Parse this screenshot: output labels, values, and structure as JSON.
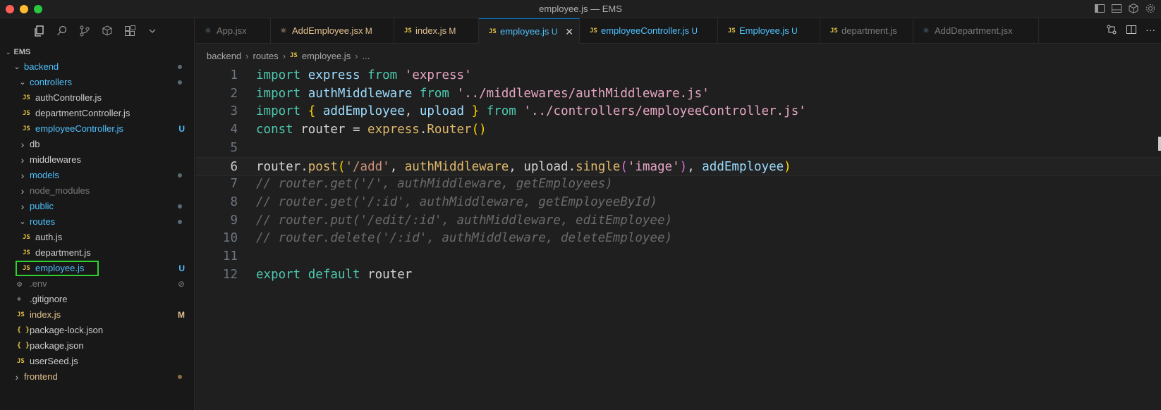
{
  "window": {
    "title": "employee.js — EMS"
  },
  "explorer": {
    "root": "EMS",
    "items": [
      {
        "label": "backend",
        "indent": 1,
        "type": "folder-open",
        "color": "#4fc1ff",
        "dot": true
      },
      {
        "label": "controllers",
        "indent": 2,
        "type": "folder-open",
        "color": "#4fc1ff",
        "dot": true
      },
      {
        "label": "authController.js",
        "indent": 3,
        "type": "js",
        "color": "#cccccc"
      },
      {
        "label": "departmentController.js",
        "indent": 3,
        "type": "js",
        "color": "#cccccc"
      },
      {
        "label": "employeeController.js",
        "indent": 3,
        "type": "js",
        "color": "#4fc1ff",
        "badge": "U",
        "badgeColor": "#4fc1ff"
      },
      {
        "label": "db",
        "indent": 2,
        "type": "folder",
        "color": "#cccccc"
      },
      {
        "label": "middlewares",
        "indent": 2,
        "type": "folder",
        "color": "#cccccc"
      },
      {
        "label": "models",
        "indent": 2,
        "type": "folder",
        "color": "#4fc1ff",
        "dot": true
      },
      {
        "label": "node_modules",
        "indent": 2,
        "type": "folder",
        "color": "#7a7a7a"
      },
      {
        "label": "public",
        "indent": 2,
        "type": "folder",
        "color": "#4fc1ff",
        "dot": true
      },
      {
        "label": "routes",
        "indent": 2,
        "type": "folder-open",
        "color": "#4fc1ff",
        "dot": true
      },
      {
        "label": "auth.js",
        "indent": 3,
        "type": "js",
        "color": "#cccccc"
      },
      {
        "label": "department.js",
        "indent": 3,
        "type": "js",
        "color": "#cccccc"
      },
      {
        "label": "employee.js",
        "indent": 3,
        "type": "js",
        "color": "#4fc1ff",
        "badge": "U",
        "badgeColor": "#4fc1ff",
        "selected": true
      },
      {
        "label": ".env",
        "indent": 2,
        "type": "gear",
        "color": "#7a7a7a",
        "badge": "⊘",
        "badgeColor": "#6a6a6a"
      },
      {
        "label": ".gitignore",
        "indent": 2,
        "type": "diamond",
        "color": "#cccccc"
      },
      {
        "label": "index.js",
        "indent": 2,
        "type": "js",
        "color": "#e2c08d",
        "badge": "M",
        "badgeColor": "#e2c08d"
      },
      {
        "label": "package-lock.json",
        "indent": 2,
        "type": "json",
        "color": "#cccccc"
      },
      {
        "label": "package.json",
        "indent": 2,
        "type": "json",
        "color": "#cccccc"
      },
      {
        "label": "userSeed.js",
        "indent": 2,
        "type": "js",
        "color": "#cccccc"
      },
      {
        "label": "frontend",
        "indent": 1,
        "type": "folder",
        "color": "#e2c08d",
        "dot": true,
        "dotColor": "#8a6a45"
      }
    ]
  },
  "tabs": [
    {
      "label": "App.jsx",
      "icon": "react-icon",
      "color": "#7a7a7a",
      "mod": ""
    },
    {
      "label": "AddEmployee.jsx",
      "icon": "react-icon",
      "color": "#e2c08d",
      "mod": "M"
    },
    {
      "label": "index.js",
      "icon": "js",
      "color": "#e2c08d",
      "mod": "M"
    },
    {
      "label": "employee.js",
      "icon": "js",
      "color": "#4fc1ff",
      "mod": "U",
      "active": true
    },
    {
      "label": "employeeController.js",
      "icon": "js",
      "color": "#4fc1ff",
      "mod": "U"
    },
    {
      "label": "Employee.js",
      "icon": "js",
      "color": "#4fc1ff",
      "mod": "U"
    },
    {
      "label": "department.js",
      "icon": "js",
      "color": "#7a7a7a",
      "mod": ""
    },
    {
      "label": "AddDepartment.jsx",
      "icon": "react-icon",
      "color": "#7a7a7a",
      "mod": ""
    }
  ],
  "breadcrumb": {
    "parts": [
      "backend",
      "routes",
      "employee.js",
      "..."
    ]
  },
  "editor": {
    "current_line": 6,
    "lines": [
      [
        [
          "kw",
          "import"
        ],
        [
          "pl",
          " "
        ],
        [
          "vr",
          "express"
        ],
        [
          "pl",
          " "
        ],
        [
          "kw",
          "from"
        ],
        [
          "pl",
          " "
        ],
        [
          "str2",
          "'express'"
        ]
      ],
      [
        [
          "kw",
          "import"
        ],
        [
          "pl",
          " "
        ],
        [
          "vr",
          "authMiddleware"
        ],
        [
          "pl",
          " "
        ],
        [
          "kw",
          "from"
        ],
        [
          "pl",
          " "
        ],
        [
          "str2",
          "'../middlewares/authMiddleware.js'"
        ]
      ],
      [
        [
          "kw",
          "import"
        ],
        [
          "pl",
          " "
        ],
        [
          "br1",
          "{"
        ],
        [
          "pl",
          " "
        ],
        [
          "vr",
          "addEmployee"
        ],
        [
          "pl",
          ", "
        ],
        [
          "vr",
          "upload"
        ],
        [
          "pl",
          " "
        ],
        [
          "br1",
          "}"
        ],
        [
          "pl",
          " "
        ],
        [
          "kw",
          "from"
        ],
        [
          "pl",
          " "
        ],
        [
          "str2",
          "'../controllers/employeeController.js'"
        ]
      ],
      [
        [
          "kw",
          "const"
        ],
        [
          "pl",
          " router = "
        ],
        [
          "fn2",
          "express"
        ],
        [
          "pl",
          "."
        ],
        [
          "fn2",
          "Router"
        ],
        [
          "br1",
          "()"
        ]
      ],
      [],
      [
        [
          "pl",
          "router."
        ],
        [
          "fn2",
          "post"
        ],
        [
          "br1",
          "("
        ],
        [
          "str",
          "'/add'"
        ],
        [
          "pl",
          ", "
        ],
        [
          "fn2",
          "authMiddleware"
        ],
        [
          "pl",
          ", upload."
        ],
        [
          "fn2",
          "single"
        ],
        [
          "br2",
          "("
        ],
        [
          "str2",
          "'image'"
        ],
        [
          "br2",
          ")"
        ],
        [
          "pl",
          ", "
        ],
        [
          "vr",
          "addEmployee"
        ],
        [
          "br1",
          ")"
        ]
      ],
      [
        [
          "cm",
          "// router.get('/', authMiddleware, getEmployees)"
        ]
      ],
      [
        [
          "cm",
          "// router.get('/:id', authMiddleware, getEmployeeById)"
        ]
      ],
      [
        [
          "cm",
          "// router.put('/edit/:id', authMiddleware, editEmployee)"
        ]
      ],
      [
        [
          "cm",
          "// router.delete('/:id', authMiddleware, deleteEmployee)"
        ]
      ],
      [],
      [
        [
          "kw",
          "export"
        ],
        [
          "pl",
          " "
        ],
        [
          "kw",
          "default"
        ],
        [
          "pl",
          " router"
        ]
      ]
    ]
  }
}
